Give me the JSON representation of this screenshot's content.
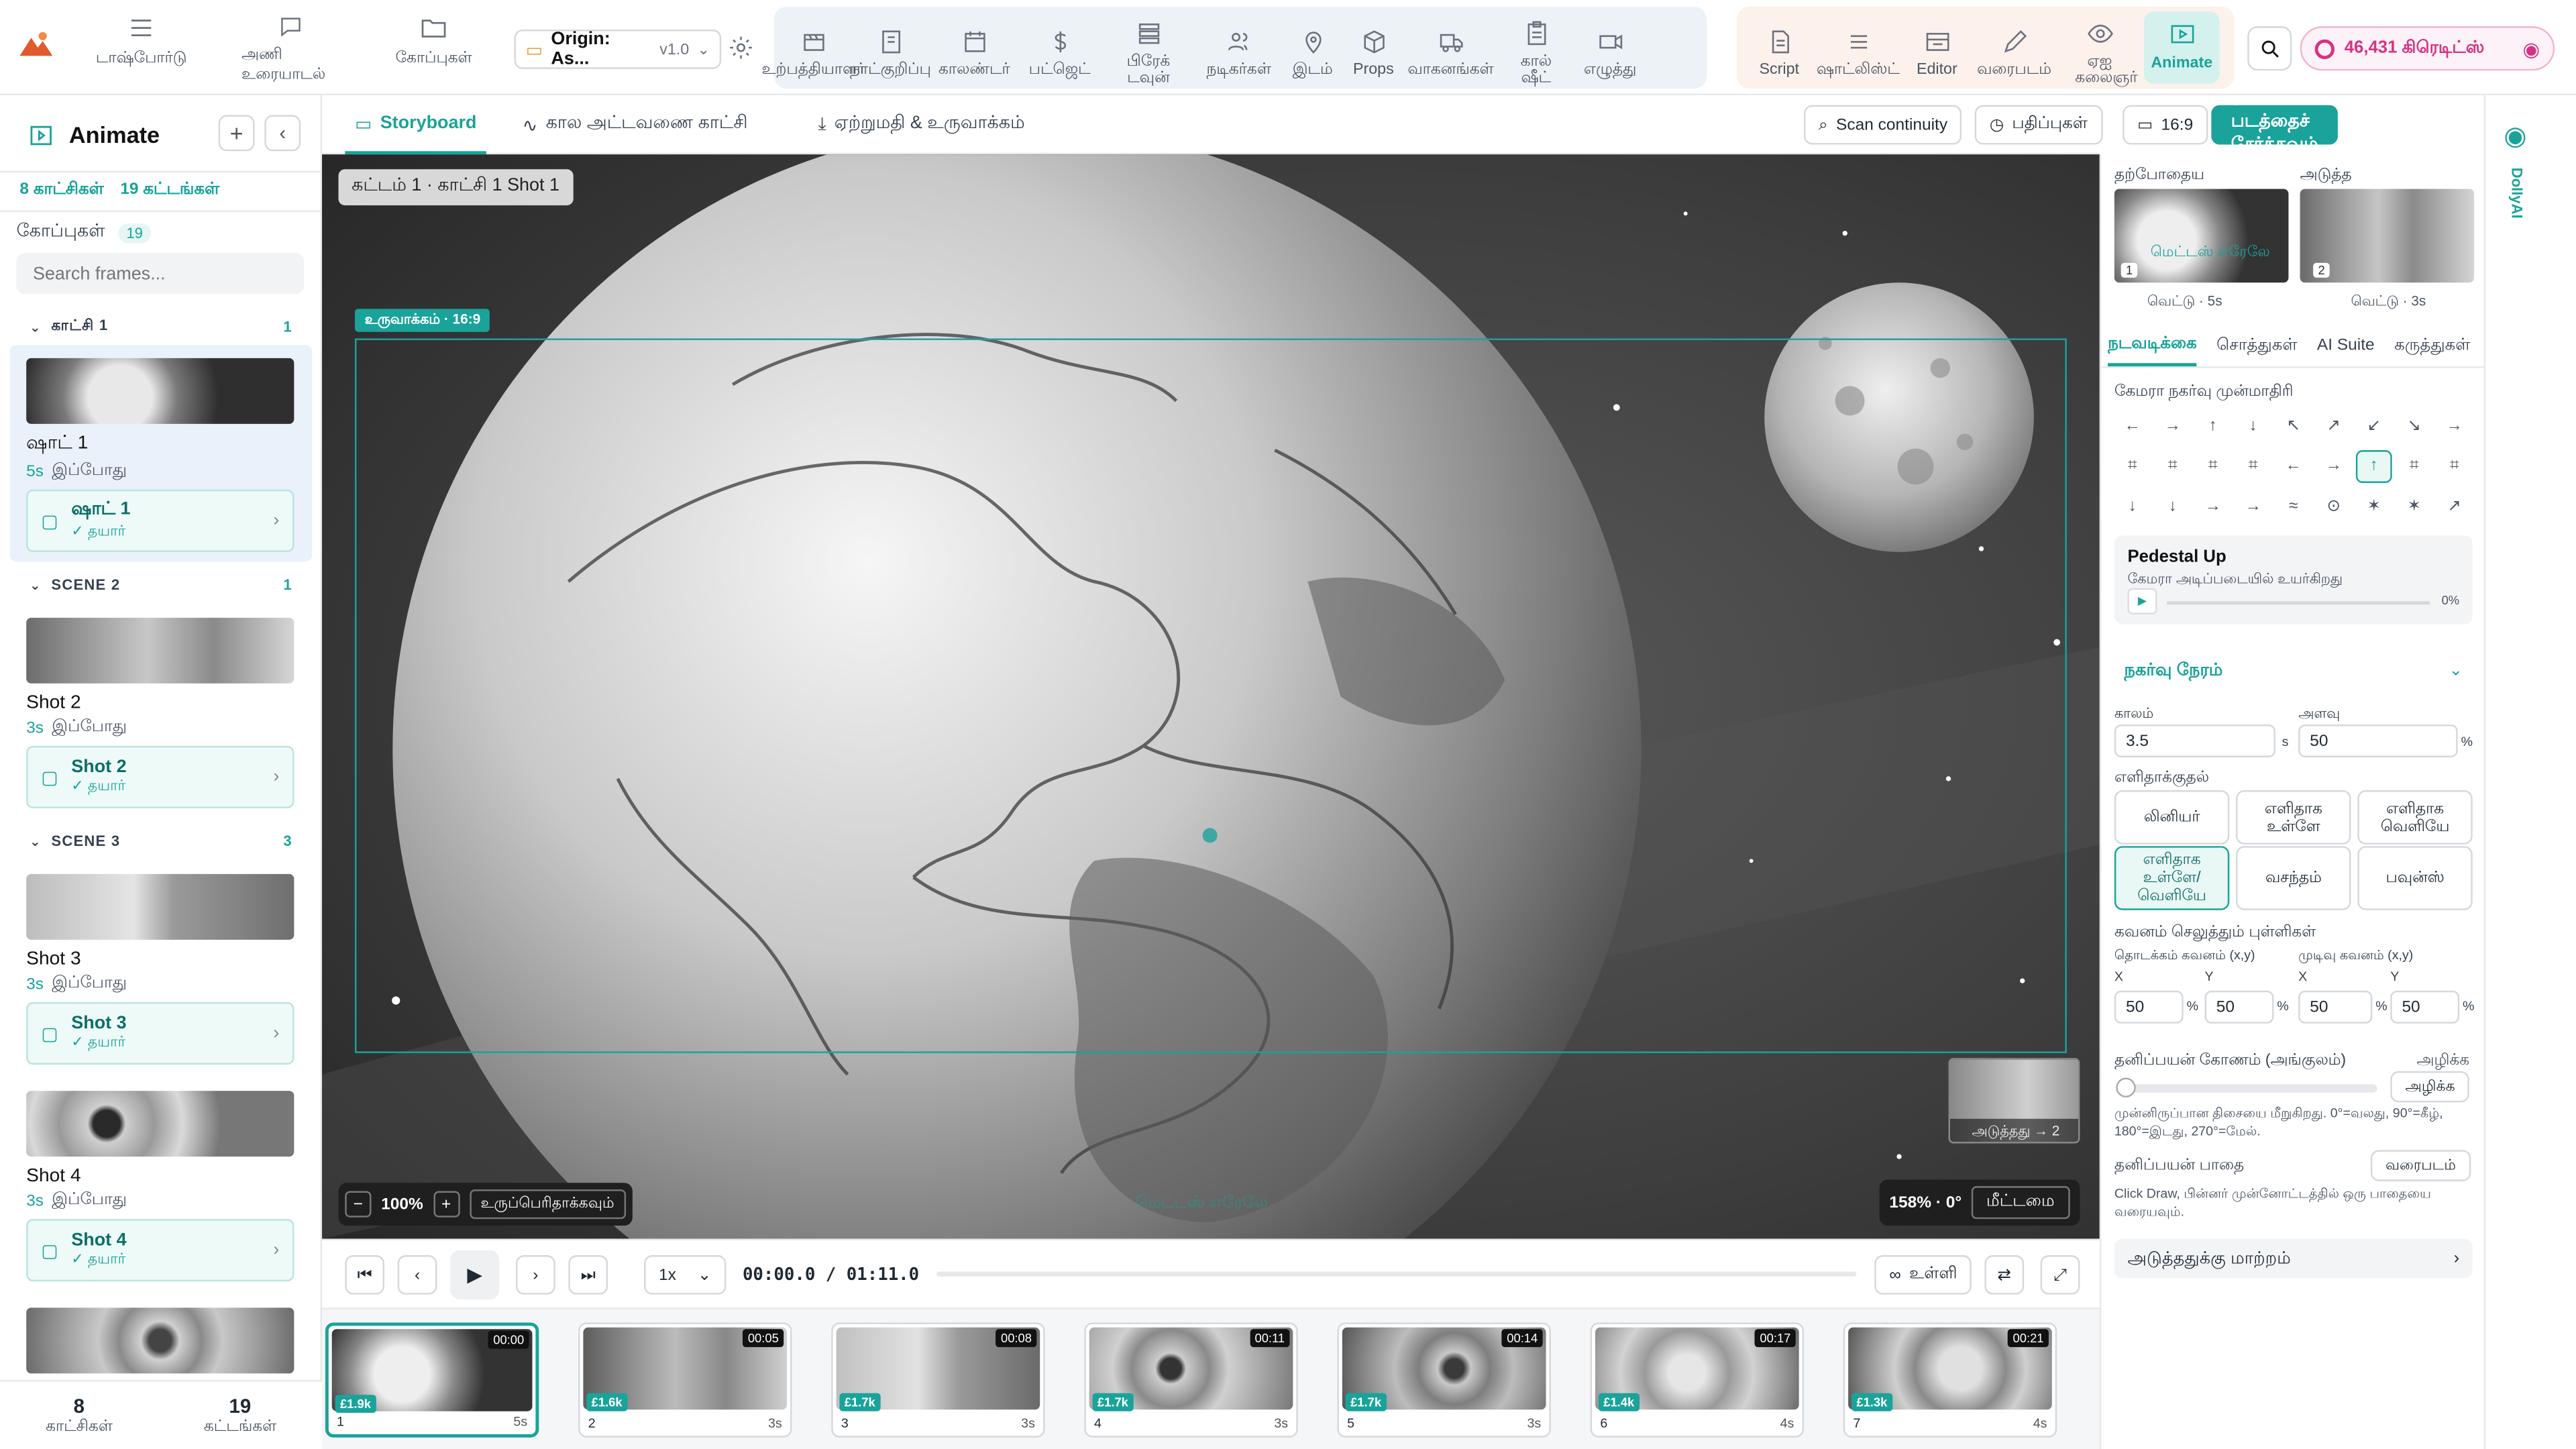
{
  "app": {
    "title": "Animate"
  },
  "topbar": {
    "nav": [
      {
        "label": "டாஷ்போர்டு",
        "icon": "grid-icon"
      },
      {
        "label": "அணி உரையாடல்",
        "icon": "chat-icon"
      },
      {
        "label": "கோப்புகள்",
        "icon": "folder-icon"
      }
    ],
    "project": {
      "name": "Origin: As...",
      "version": "v1.0"
    },
    "tools": [
      {
        "label": "உற்பத்தியாளர்",
        "icon": "clapper-icon"
      },
      {
        "label": "நாட்குறிப்பு",
        "icon": "notebook-icon"
      },
      {
        "label": "காலண்டர்",
        "icon": "calendar-icon"
      },
      {
        "label": "பட்ஜெட்",
        "icon": "dollar-icon"
      },
      {
        "label": "பிரேக் டவுன்",
        "icon": "breakdown-icon"
      },
      {
        "label": "நடிகர்கள்",
        "icon": "people-icon"
      },
      {
        "label": "இடம்",
        "icon": "location-icon"
      },
      {
        "label": "Props",
        "icon": "cube-icon"
      },
      {
        "label": "வாகனங்கள்",
        "icon": "truck-icon"
      },
      {
        "label": "கால் ஷீட்",
        "icon": "clipboard-icon"
      },
      {
        "label": "எழுத்து",
        "icon": "camera-icon"
      }
    ],
    "modes": [
      {
        "label": "Script",
        "icon": "script-icon"
      },
      {
        "label": "ஷாட்லிஸ்ட்",
        "icon": "list-icon"
      },
      {
        "label": "Editor",
        "icon": "editor-icon"
      },
      {
        "label": "வரைபடம்",
        "icon": "pencil-icon"
      },
      {
        "label": "ஏஐ கலைஞர்",
        "icon": "eye-icon"
      },
      {
        "label": "Animate",
        "icon": "animate-icon"
      }
    ],
    "credits": "46,431 கிரெடிட்ஸ்"
  },
  "sidebar": {
    "title": "Animate",
    "scenes_count": "8 காட்சிகள்",
    "frames_count": "19 கட்டங்கள்",
    "files_label": "கோப்புகள்",
    "files_count": "19",
    "search_placeholder": "Search frames...",
    "scenes": [
      {
        "name": "காட்சி 1",
        "count": "1",
        "shot": "ஷாட் 1",
        "duration": "5s",
        "time": "இப்போது",
        "sub": "ஷாட் 1",
        "status": "✓ தயார்"
      },
      {
        "name": "SCENE 2",
        "count": "1",
        "shot": "Shot 2",
        "duration": "3s",
        "time": "இப்போது",
        "sub": "Shot 2",
        "status": "✓ தயார்"
      },
      {
        "name": "SCENE 3",
        "count": "3",
        "shot": "Shot 3",
        "duration": "3s",
        "time": "இப்போது",
        "sub": "Shot 3",
        "status": "✓ தயார்"
      },
      {
        "name": "",
        "count": "",
        "shot": "Shot 4",
        "duration": "3s",
        "time": "இப்போது",
        "sub": "Shot 4",
        "status": "✓ தயார்"
      }
    ],
    "footer": {
      "scenes_num": "8",
      "scenes_label": "காட்சிகள்",
      "frames_num": "19",
      "frames_label": "கட்டங்கள்"
    }
  },
  "tabs": {
    "items": [
      "Storyboard",
      "கால அட்டவணை காட்சி",
      "ஏற்றுமதி & உருவாக்கம்"
    ],
    "scan": "Scan continuity",
    "versions": "பதிப்புகள்",
    "ratio": "16:9",
    "add_scene": "+ படத்தைச் சேர்க்கவும்"
  },
  "stage": {
    "breadcrumb": "கட்டம் 1 · காட்சி 1 Shot 1",
    "frame_label": "உருவாக்கம் · 16:9",
    "zoom": "100%",
    "expand": "உருப்பெரிதாக்கவும்",
    "next_label": "அடுத்தது → 2",
    "angle": "158% · 0°",
    "reset": "மீட்டமை",
    "ghost_caption": "மெட்டஸ் எரேலே"
  },
  "transport": {
    "speed": "1x",
    "time": "00:00.0 / 01:11.0",
    "inside": "உள்ளி"
  },
  "filmstrip": [
    {
      "num": "1",
      "time": "00:00",
      "cost": "£1.9k",
      "dur": "5s"
    },
    {
      "num": "2",
      "time": "00:05",
      "cost": "£1.6k",
      "dur": "3s"
    },
    {
      "num": "3",
      "time": "00:08",
      "cost": "£1.7k",
      "dur": "3s"
    },
    {
      "num": "4",
      "time": "00:11",
      "cost": "£1.7k",
      "dur": "3s"
    },
    {
      "num": "5",
      "time": "00:14",
      "cost": "£1.7k",
      "dur": "3s"
    },
    {
      "num": "6",
      "time": "00:17",
      "cost": "£1.4k",
      "dur": "4s"
    },
    {
      "num": "7",
      "time": "00:21",
      "cost": "£1.3k",
      "dur": "4s"
    }
  ],
  "rpanel": {
    "current": "தற்போதைய",
    "next": "அடுத்த",
    "current_cut": "வெட்டு · 5s",
    "next_cut": "வெட்டு · 3s",
    "current_caption": "மெட்டஸ் எரேலே",
    "tabs": [
      "நடவடிக்கை",
      "சொத்துகள்",
      "AI Suite",
      "கருத்துகள்"
    ],
    "preset_title": "கேமரா நகர்வு முன்மாதிரி",
    "preset_glyphs": [
      "←",
      "→",
      "↑",
      "↓",
      "↖",
      "↗",
      "↙",
      "↘",
      "→",
      "⌗",
      "⌗",
      "⌗",
      "⌗",
      "←",
      "→",
      "↑",
      "⌗",
      "⌗",
      "↓",
      "↓",
      "→",
      "→",
      "≈",
      "⊙",
      "✶",
      "✶",
      "↗"
    ],
    "move_name": "Pedestal Up",
    "move_desc": "கேமரா அடிப்படையில் உயர்கிறது",
    "move_progress": "0%",
    "timing_title": "நகர்வு நேரம்",
    "duration_label": "காலம்",
    "duration_value": "3.5",
    "duration_unit": "s",
    "amount_label": "அளவு",
    "amount_value": "50",
    "amount_unit": "%",
    "easing_label": "எளிதாக்குதல்",
    "easings": [
      "லினியர்",
      "எளிதாக உள்ளே",
      "எளிதாக வெளியே",
      "எளிதாக உள்ளே/வெளியே",
      "வசந்தம்",
      "பவுன்ஸ்"
    ],
    "focus_title": "கவனம் செலுத்தும் புள்ளிகள்",
    "focus_start": "தொடக்கம் கவனம் (x,y)",
    "focus_end": "முடிவு கவனம் (x,y)",
    "x": "X",
    "y": "Y",
    "focus_values": [
      "50",
      "50",
      "50",
      "50"
    ],
    "custom_angle": "தனிப்பயன் கோணம் (அங்குலம்)",
    "clear": "அழிக்க",
    "clear_btn": "அழிக்க",
    "angle_help": "முன்னிருப்பான திசையை மீறுகிறது. 0°=வலது, 90°=கீழ், 180°=இடது, 270°=மேல்.",
    "path_title": "தனிப்பயன் பாதை",
    "draw_btn": "வரைபடம்",
    "path_help": "Click Draw, பின்னர் முன்னோட்டத்தில் ஒரு பாதையை வரையவும்.",
    "next_transition": "அடுத்ததுக்கு மாற்றம்"
  },
  "rstrip": {
    "label": "DollyAI"
  },
  "colors": {
    "accent": "#1aa39a",
    "accent_bg": "#eefaf8",
    "credit": "#d63384"
  }
}
